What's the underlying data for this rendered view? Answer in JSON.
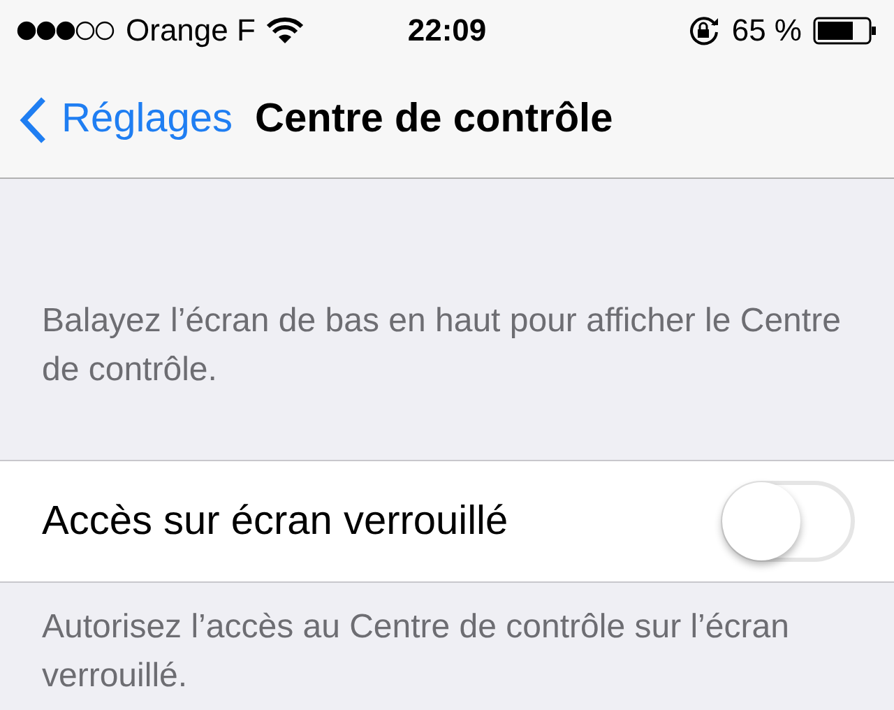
{
  "status_bar": {
    "carrier": "Orange F",
    "time": "22:09",
    "battery": "65 %"
  },
  "nav": {
    "back": "Réglages",
    "title": "Centre de contrôle"
  },
  "header_note": "Balayez l’écran de bas en haut pour afficher le Centre de contrôle.",
  "settings": [
    {
      "label": "Accès sur écran verrouillé",
      "on": false
    }
  ],
  "footer_note": "Autorisez l’accès au Centre de contrôle sur l’écran verrouillé."
}
